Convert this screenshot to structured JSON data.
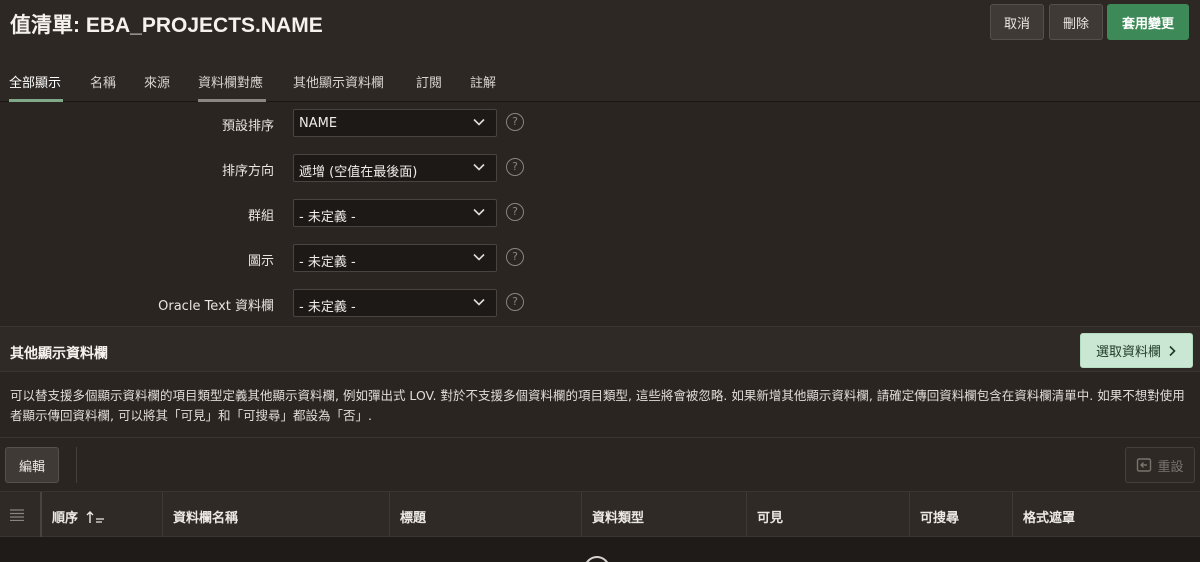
{
  "header": {
    "title": "值清單: EBA_PROJECTS.NAME",
    "buttons": {
      "cancel": "取消",
      "delete": "刪除",
      "apply": "套用變更"
    }
  },
  "tabs": [
    {
      "label": "全部顯示",
      "state": "active"
    },
    {
      "label": "名稱",
      "state": ""
    },
    {
      "label": "來源",
      "state": ""
    },
    {
      "label": "資料欄對應",
      "state": "current"
    },
    {
      "label": "其他顯示資料欄",
      "state": ""
    },
    {
      "label": "訂閱",
      "state": ""
    },
    {
      "label": "註解",
      "state": ""
    }
  ],
  "form": {
    "default_sort": {
      "label": "預設排序",
      "value": "NAME"
    },
    "sort_direction": {
      "label": "排序方向",
      "value": "遞增 (空值在最後面)"
    },
    "group": {
      "label": "群組",
      "value": "- 未定義 -"
    },
    "icon": {
      "label": "圖示",
      "value": "- 未定義 -"
    },
    "oracle_text": {
      "label": "Oracle Text 資料欄",
      "value": "- 未定義 -"
    },
    "help_glyph": "?"
  },
  "additional_columns": {
    "title": "其他顯示資料欄",
    "select_button": "選取資料欄",
    "description": "可以替支援多個顯示資料欄的項目類型定義其他顯示資料欄, 例如彈出式 LOV. 對於不支援多個資料欄的項目類型, 這些將會被忽略. 如果新增其他顯示資料欄, 請確定傳回資料欄包含在資料欄清單中. 如果不想對使用者顯示傳回資料欄, 可以將其「可見」和「可搜尋」都設為「否」."
  },
  "toolbar": {
    "edit": "編輯",
    "reset": "重設"
  },
  "grid": {
    "columns": [
      "順序",
      "資料欄名稱",
      "標題",
      "資料類型",
      "可見",
      "可搜尋",
      "格式遮罩"
    ]
  },
  "colors": {
    "background": "#2a2521",
    "accent_green": "#3d8a58",
    "active_tab_bar": "#7fa989",
    "select_button_bg": "#c9e7d2"
  }
}
